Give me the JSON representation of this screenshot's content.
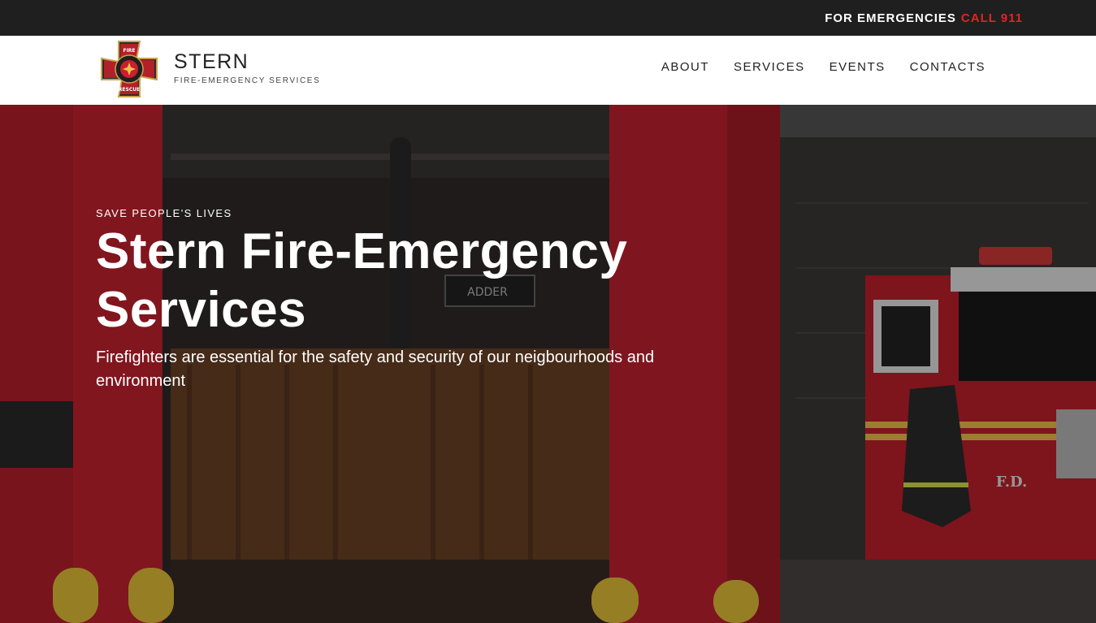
{
  "topbar": {
    "emergency_label": "FOR EMERGENCIES",
    "call_label": "CALL 911",
    "call_color": "#e02424"
  },
  "header": {
    "logo_icon": "fire-rescue-badge-icon",
    "logo_text": {
      "top": "FIRE",
      "bottom": "RESCUE",
      "left": "COURAGE",
      "right": "HONOR"
    },
    "brand_name": "STERN",
    "brand_tagline": "FIRE-EMERGENCY SERVICES",
    "nav": [
      {
        "label": "ABOUT"
      },
      {
        "label": "SERVICES"
      },
      {
        "label": "EVENTS"
      },
      {
        "label": "CONTACTS"
      }
    ]
  },
  "hero": {
    "eyebrow": "SAVE PEOPLE'S LIVES",
    "title": "Stern Fire-Emergency Services",
    "subtitle": "Firefighters are essential for the safety and security of our neigbourhoods and environment",
    "truck_marking": "F.D.",
    "sign_text": "ADDER",
    "accent_color": "#c8202e"
  }
}
